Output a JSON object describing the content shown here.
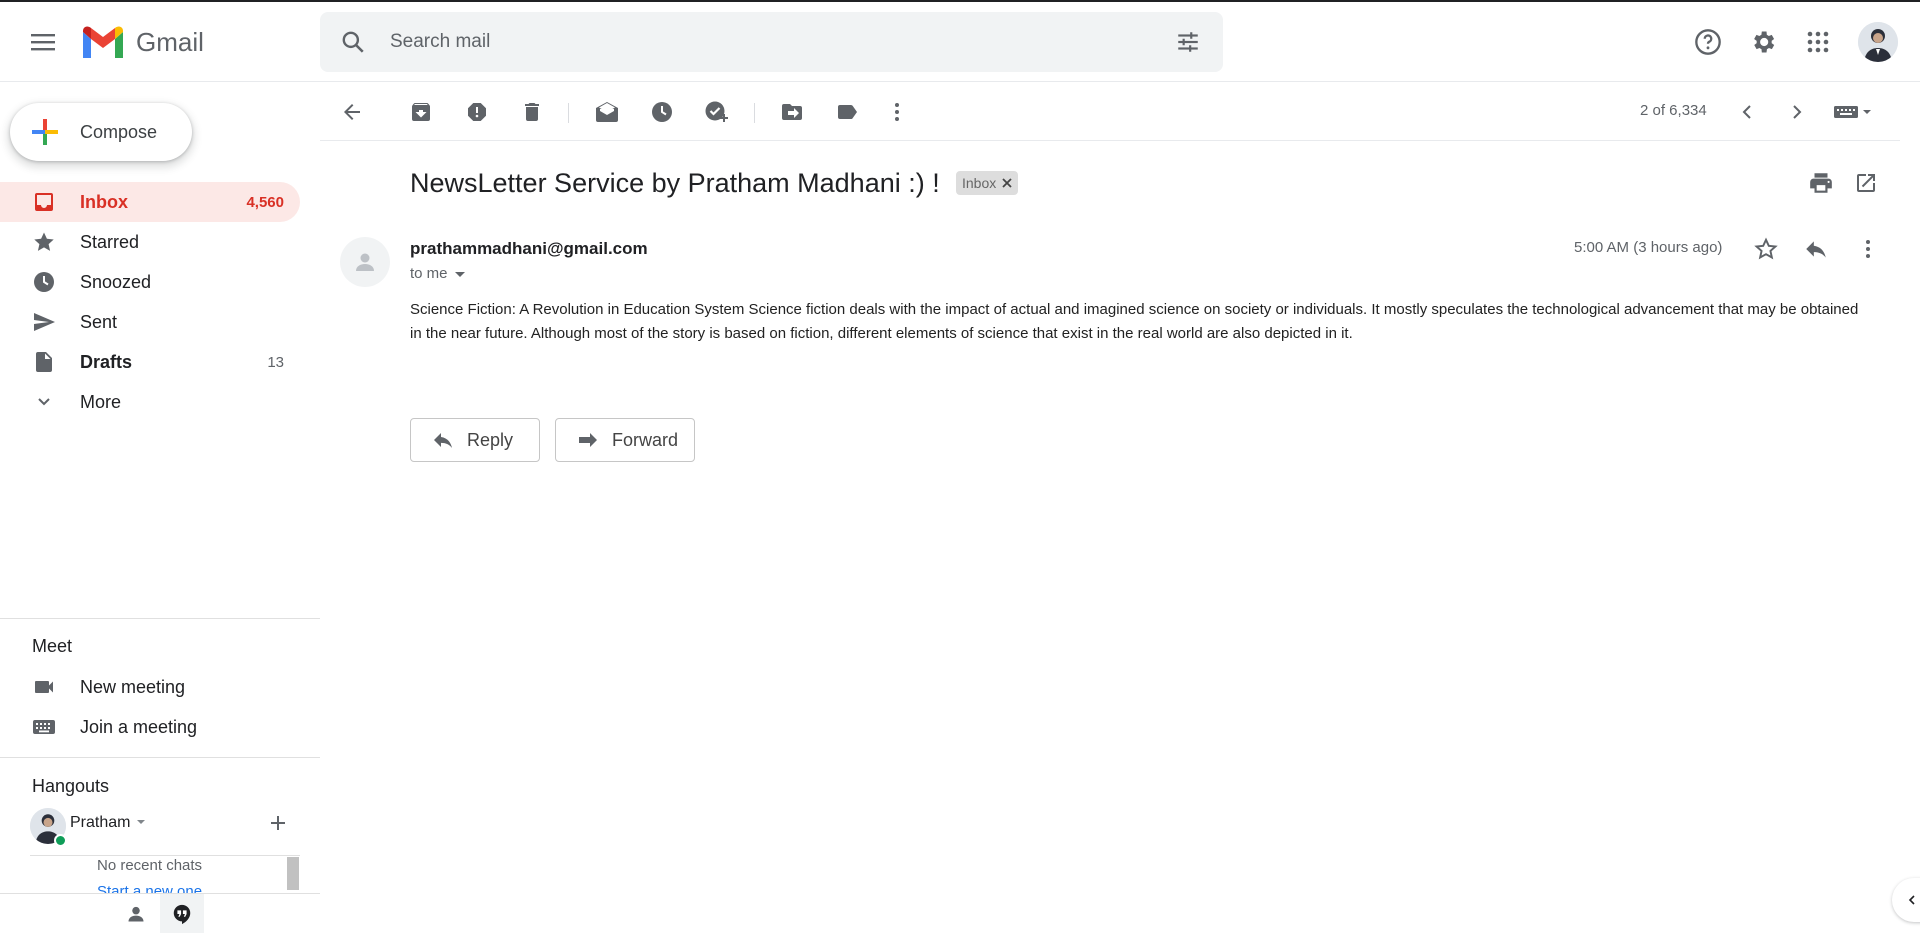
{
  "app": {
    "name": "Gmail"
  },
  "search": {
    "placeholder": "Search mail"
  },
  "compose": {
    "label": "Compose"
  },
  "nav": [
    {
      "label": "Inbox",
      "count": "4,560",
      "icon": "inbox-icon"
    },
    {
      "label": "Starred",
      "count": "",
      "icon": "star-icon"
    },
    {
      "label": "Snoozed",
      "count": "",
      "icon": "clock-icon"
    },
    {
      "label": "Sent",
      "count": "",
      "icon": "send-icon"
    },
    {
      "label": "Drafts",
      "count": "13",
      "icon": "draft-icon"
    },
    {
      "label": "More",
      "count": "",
      "icon": "chevron-down-icon"
    }
  ],
  "meet": {
    "title": "Meet",
    "items": [
      {
        "label": "New meeting",
        "icon": "video-icon"
      },
      {
        "label": "Join a meeting",
        "icon": "keyboard-icon"
      }
    ]
  },
  "hangouts": {
    "title": "Hangouts",
    "user": "Pratham",
    "no_chats": "No recent chats",
    "start_new": "Start a new one"
  },
  "toolbar": {
    "pager": "2 of 6,334"
  },
  "email": {
    "subject": "NewsLetter Service by Pratham Madhani :) !",
    "label_chip": "Inbox",
    "sender": "prathammadhani@gmail.com",
    "recipient": "to me",
    "timestamp": "5:00 AM (3 hours ago)",
    "body": "Science Fiction: A Revolution in Education System Science fiction deals with the impact of actual and imagined science on society or individuals. It mostly speculates the technological advancement that may be obtained in the near future. Although most of the story is based on fiction, different elements of science that exist in the real world are also depicted in it."
  },
  "actions": {
    "reply": "Reply",
    "forward": "Forward"
  },
  "colors": {
    "accent_red": "#d93025",
    "active_bg": "#fce8e6",
    "online": "#0f9d58",
    "link": "#1a73e8"
  }
}
